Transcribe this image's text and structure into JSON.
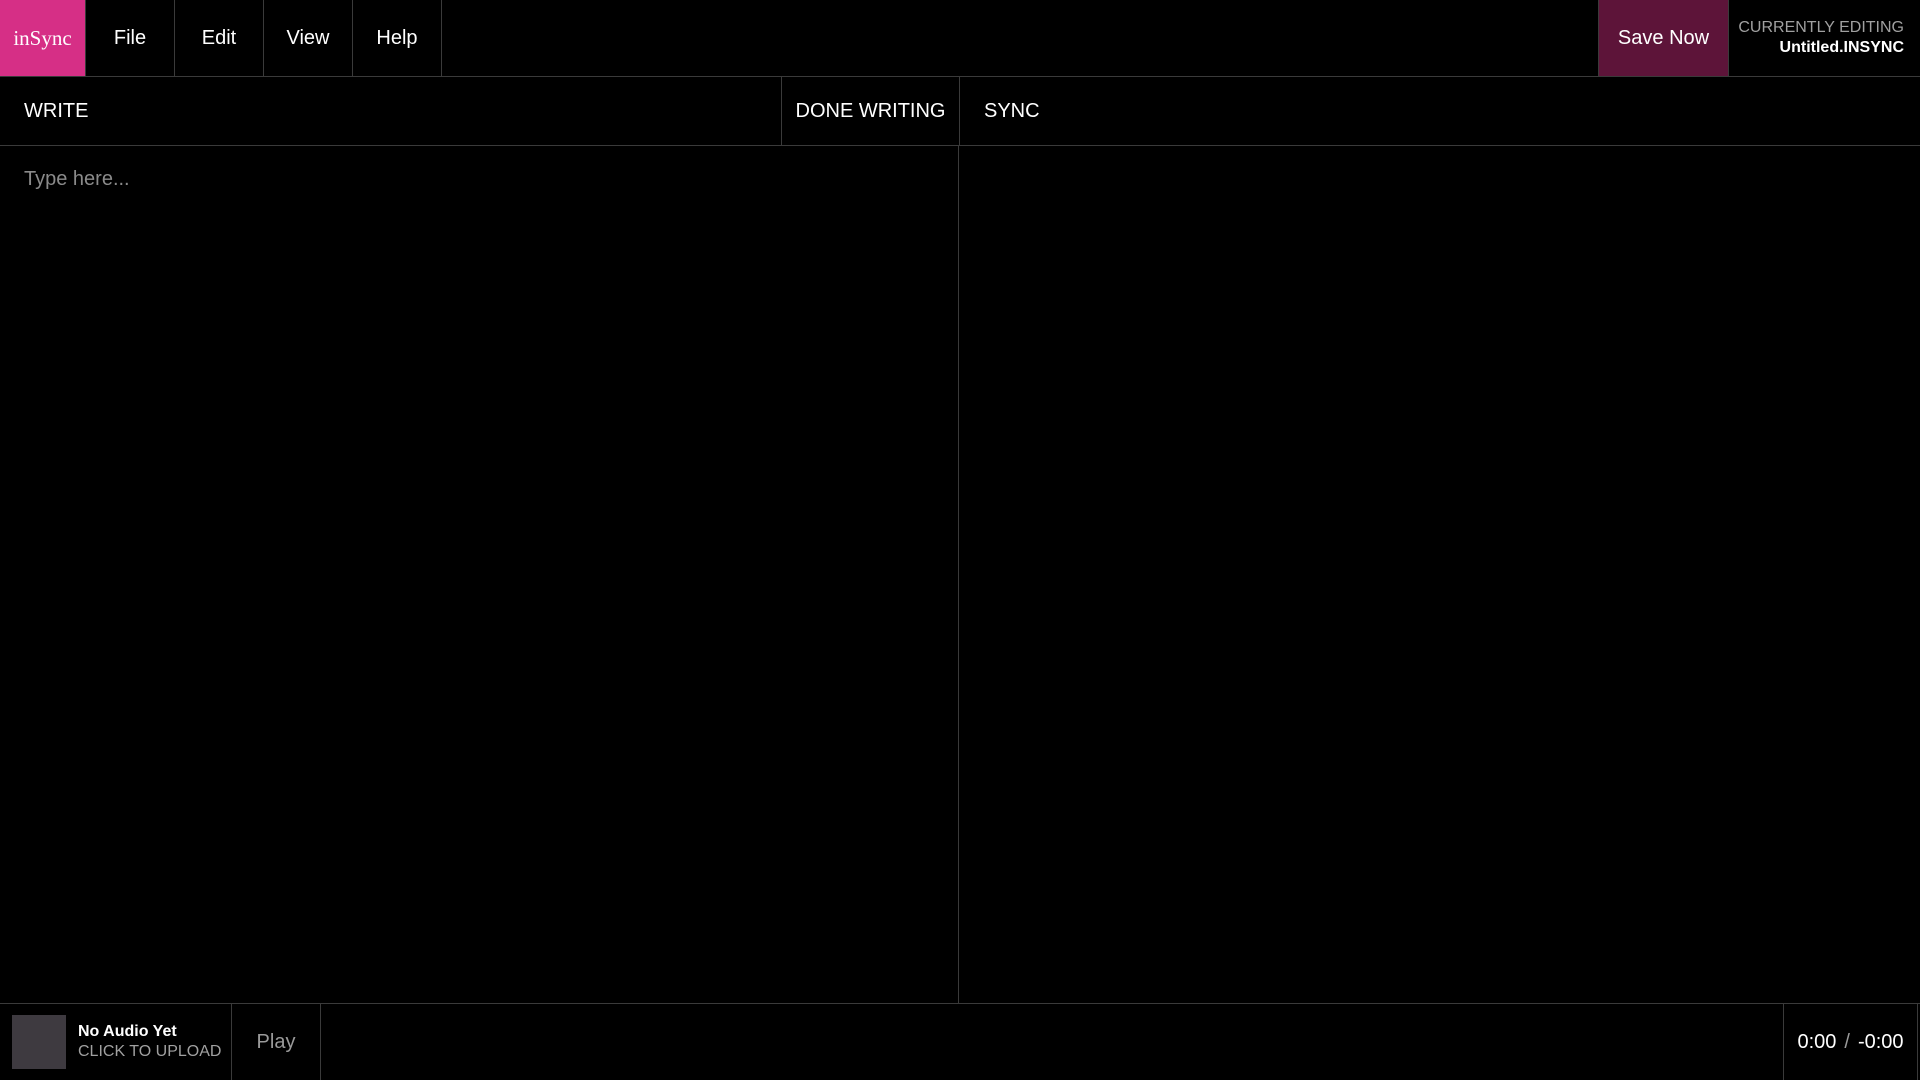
{
  "app": {
    "logo": "inSync"
  },
  "menu": {
    "items": [
      {
        "label": "File"
      },
      {
        "label": "Edit"
      },
      {
        "label": "View"
      },
      {
        "label": "Help"
      }
    ]
  },
  "toolbar": {
    "save_label": "Save Now",
    "editing_label": "CURRENTLY EDITING",
    "editing_file": "Untitled.INSYNC"
  },
  "sections": {
    "write_label": "WRITE",
    "done_writing_label": "DONE WRITING",
    "sync_label": "SYNC"
  },
  "editor": {
    "value": "",
    "placeholder": "Type here..."
  },
  "player": {
    "audio_title": "No Audio Yet",
    "audio_subtitle": "CLICK TO UPLOAD",
    "play_label": "Play",
    "current_time": "0:00",
    "separator": "/",
    "remaining_time": "-0:00"
  },
  "colors": {
    "accent": "#d62f86",
    "save_bg": "#5d1439",
    "background": "#000000"
  }
}
